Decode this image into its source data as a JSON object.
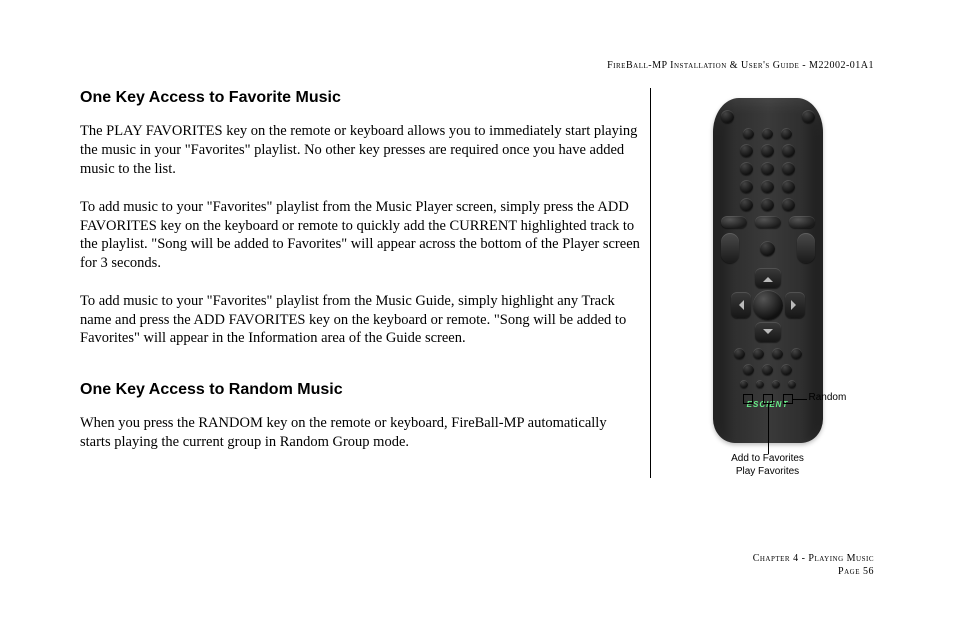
{
  "header": {
    "line": "FireBall-MP Installation & User's Guide - M22002-01A1"
  },
  "section1": {
    "title": "One Key Access to Favorite Music",
    "p1": "The PLAY FAVORITES key on the remote or keyboard allows you to immediately start playing the music in your \"Favorites\" playlist. No other key presses are required once you have added music to the list.",
    "p2": "To add music to your \"Favorites\" playlist from the Music Player screen, simply press the ADD FAVORITES key on the keyboard or remote to quickly add the CURRENT highlighted track to the playlist. \"Song will be added to Favorites\" will appear across the bottom of the Player screen for 3 seconds.",
    "p3": "To add music to your \"Favorites\" playlist from the Music Guide, simply highlight any Track name and press the ADD FAVORITES key on the keyboard or remote. \"Song will be added to Favorites\" will appear in the Information area of the Guide screen."
  },
  "section2": {
    "title": "One Key Access to Random Music",
    "p1": "When you press the RANDOM key on the remote or keyboard, FireBall-MP automatically starts playing the current group in Random Group mode."
  },
  "figure": {
    "callout_random": "Random",
    "caption_line1": "Add to Favorites",
    "caption_line2": "Play Favorites",
    "logo_text": "ESCIENT"
  },
  "footer": {
    "chapter": "Chapter 4 - Playing Music",
    "page": "Page 56"
  }
}
